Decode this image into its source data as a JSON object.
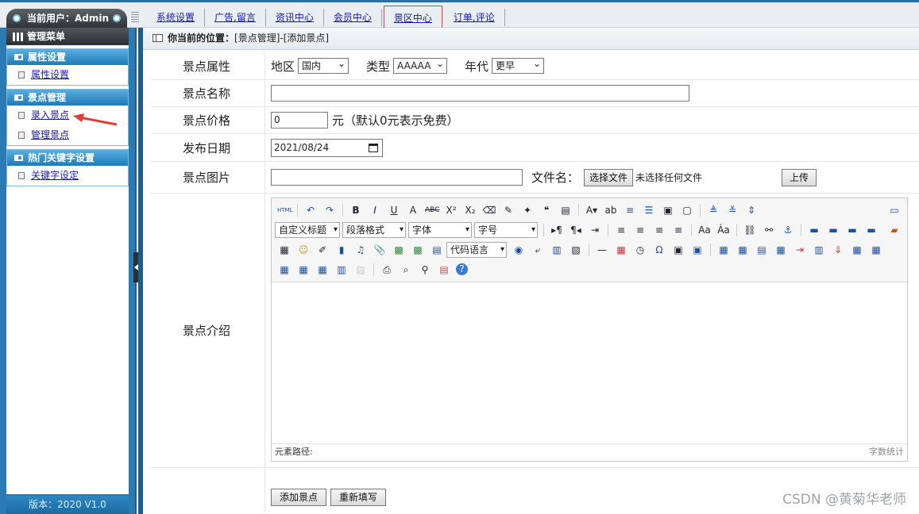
{
  "header": {
    "user_label": "当前用户：Admin",
    "tabs": [
      "系统设置",
      "广告,留言",
      "资讯中心",
      "会员中心",
      "景区中心",
      "订单,评论"
    ],
    "active_tab": "景区中心"
  },
  "sidebar": {
    "menu_title": "管理菜单",
    "groups": [
      {
        "title": "属性设置",
        "items": [
          "属性设置"
        ]
      },
      {
        "title": "景点管理",
        "items": [
          "录入景点",
          "管理景点"
        ]
      },
      {
        "title": "热门关键字设置",
        "items": [
          "关键字设定"
        ]
      }
    ],
    "version": "版本：2020 V1.0"
  },
  "breadcrumb": {
    "prefix": "你当前的位置：",
    "path": "[景点管理]-[添加景点]"
  },
  "form": {
    "attr": {
      "label": "景点属性",
      "region_label": "地区",
      "region_value": "国内",
      "type_label": "类型",
      "type_value": "AAAAA",
      "era_label": "年代",
      "era_value": "更早"
    },
    "name": {
      "label": "景点名称",
      "value": ""
    },
    "price": {
      "label": "景点价格",
      "value": "0",
      "hint": "元（默认0元表示免费）"
    },
    "date": {
      "label": "发布日期",
      "value": "2021/08/24"
    },
    "image": {
      "label": "景点图片",
      "value": "",
      "file_label": "文件名：",
      "choose_button": "选择文件",
      "no_file": "未选择任何文件",
      "upload_button": "上传"
    },
    "intro": {
      "label": "景点介绍"
    },
    "add_button": "添加景点",
    "reset_button": "重新填写"
  },
  "editor": {
    "dropdowns": [
      "自定义标题",
      "段落格式",
      "字体",
      "字号"
    ],
    "code_dropdown": "代码语言",
    "path_label": "元素路径:",
    "word_count": "字数统计"
  },
  "watermark": "CSDN @黄菊华老师"
}
